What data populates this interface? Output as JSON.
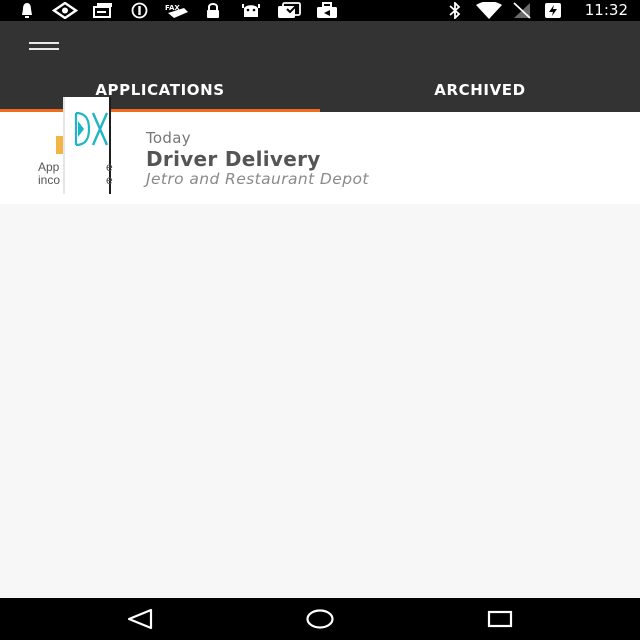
{
  "status_bar": {
    "time": "11:32",
    "left_icons": [
      "notification-icon",
      "eye-icon",
      "message-icon",
      "do-not-disturb-icon",
      "fax-icon",
      "lock-icon",
      "android-icon",
      "checklist-icon",
      "briefcase-icon"
    ],
    "right_icons": [
      "bluetooth-icon",
      "wifi-icon",
      "signal-off-icon",
      "battery-charging-icon"
    ]
  },
  "app_bar": {
    "menu_icon": "hamburger-menu-icon",
    "tabs": [
      {
        "label": "APPLICATIONS",
        "selected": true
      },
      {
        "label": "ARCHIVED",
        "selected": false
      }
    ],
    "accent_color": "#f26a1b",
    "background_color": "#333333"
  },
  "applications": [
    {
      "date": "Today",
      "title": "Driver Delivery",
      "company": "Jetro and Restaurant Depot",
      "thumbnail_text_line1": "App",
      "thumbnail_text_line2": "inco",
      "thumbnail_suffix_line1": "e",
      "thumbnail_suffix_line2": "e",
      "logo_icon": "dx-logo-icon"
    }
  ],
  "nav_bar": {
    "back_icon": "back-triangle-icon",
    "home_icon": "home-circle-icon",
    "recents_icon": "recents-square-icon"
  }
}
